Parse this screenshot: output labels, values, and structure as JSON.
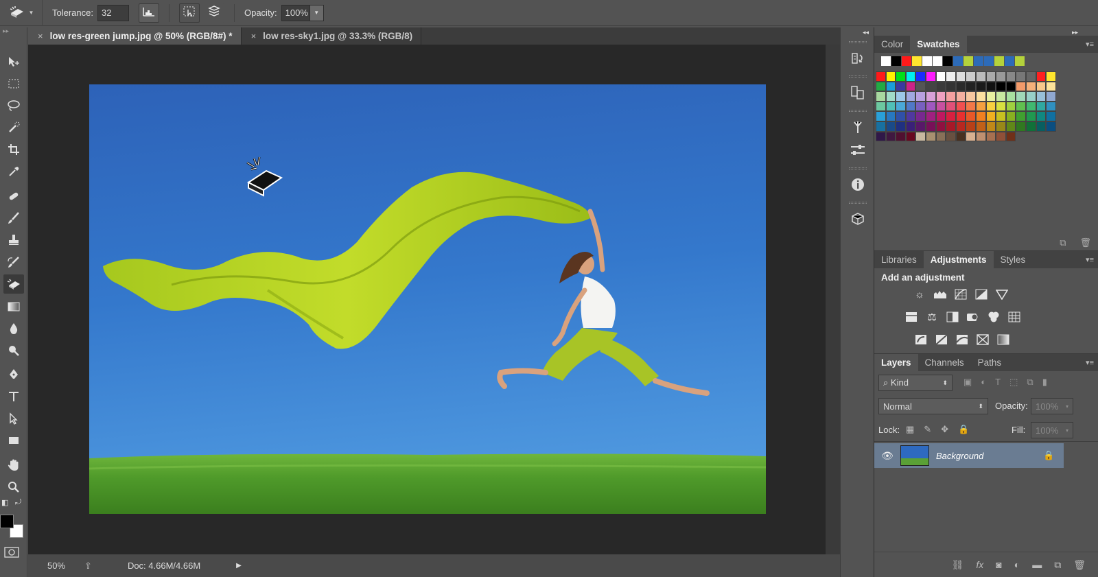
{
  "options_bar": {
    "tolerance_label": "Tolerance:",
    "tolerance_value": "32",
    "opacity_label": "Opacity:",
    "opacity_value": "100%"
  },
  "document_tabs": [
    {
      "label": "low res-green jump.jpg @ 50% (RGB/8#) *",
      "active": true
    },
    {
      "label": "low res-sky1.jpg @ 33.3% (RGB/8)",
      "active": false
    }
  ],
  "status_bar": {
    "zoom": "50%",
    "doc_size": "Doc: 4.66M/4.66M"
  },
  "color_panel": {
    "tabs": [
      "Color",
      "Swatches"
    ],
    "active_tab": "Swatches",
    "recent_swatches": [
      "#ffffff",
      "#000000",
      "#ff1a1a",
      "#ffe62e",
      "#ffffff",
      "#ffffff",
      "#000000",
      "#2d6bb8",
      "#b4d23c",
      "#2d6bb8",
      "#2d6bb8",
      "#b4d23c",
      "#2d6bb8",
      "#b4d23c"
    ]
  },
  "adjustments_panel": {
    "tabs": [
      "Libraries",
      "Adjustments",
      "Styles"
    ],
    "active_tab": "Adjustments",
    "heading": "Add an adjustment"
  },
  "layers_panel": {
    "tabs": [
      "Layers",
      "Channels",
      "Paths"
    ],
    "active_tab": "Layers",
    "filter_kind": "Kind",
    "blend_mode": "Normal",
    "opacity_label": "Opacity:",
    "opacity_value": "100%",
    "lock_label": "Lock:",
    "fill_label": "Fill:",
    "fill_value": "100%",
    "layers": [
      {
        "name": "Background",
        "visible": true,
        "locked": true
      }
    ]
  },
  "icons": {
    "toolbox": [
      "move-icon",
      "marquee-icon",
      "lasso-icon",
      "quick-selection-icon",
      "crop-icon",
      "eyedropper-icon",
      "healing-brush-icon",
      "brush-icon",
      "clone-stamp-icon",
      "history-brush-icon",
      "magic-eraser-icon",
      "gradient-icon",
      "blur-icon",
      "dodge-icon",
      "pen-icon",
      "type-icon",
      "path-selection-icon",
      "rectangle-icon",
      "hand-icon",
      "zoom-icon"
    ]
  }
}
